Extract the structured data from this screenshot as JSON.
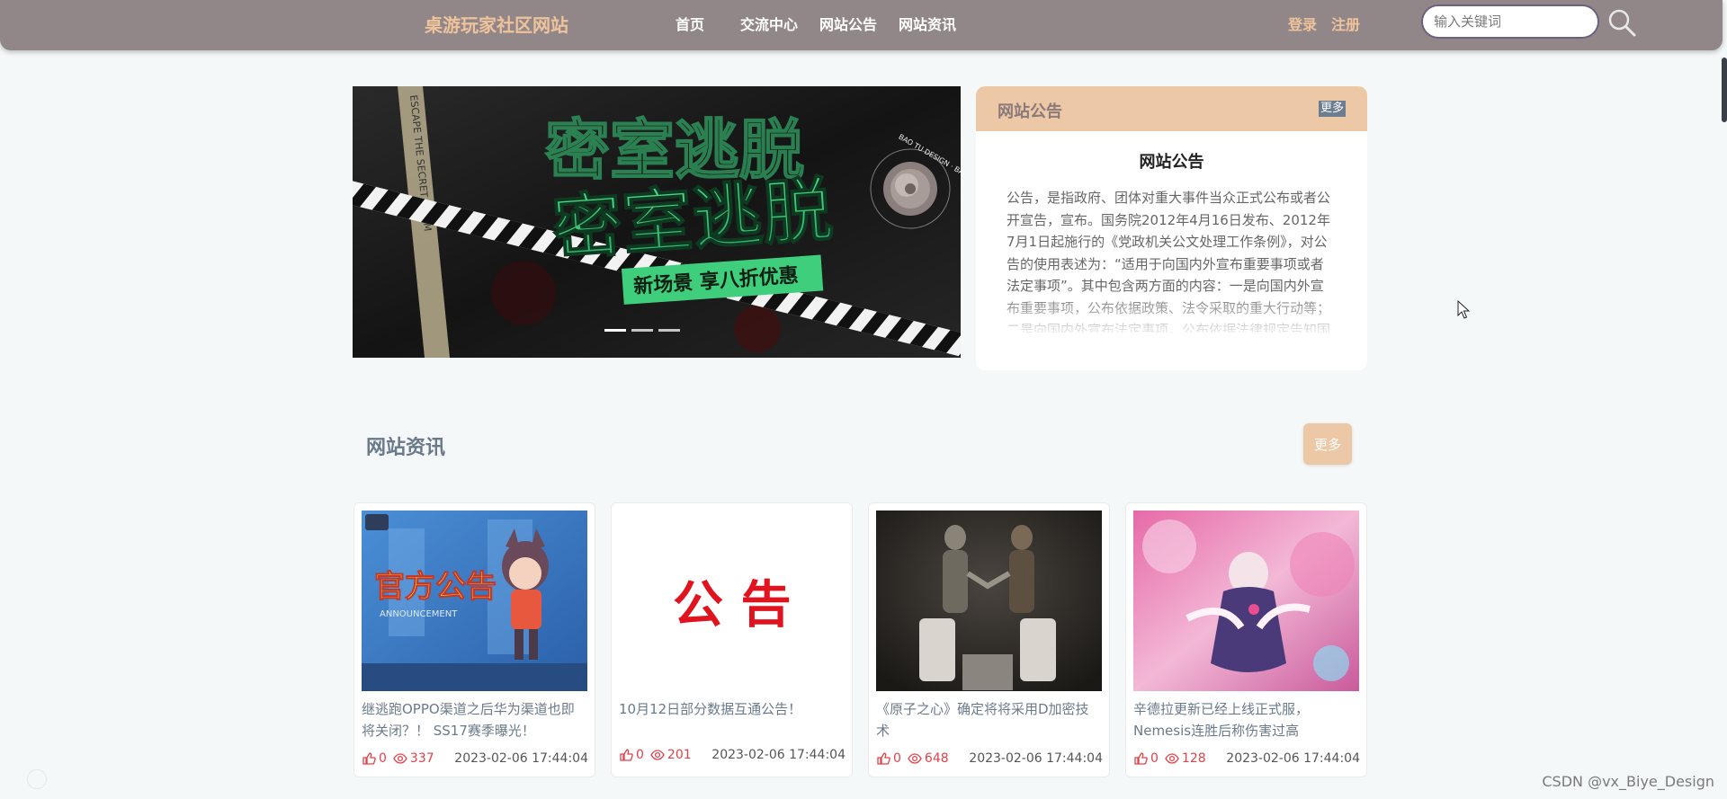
{
  "header": {
    "site_title": "桌游玩家社区网站",
    "nav": [
      "首页",
      "交流中心",
      "网站公告",
      "网站资讯"
    ],
    "login": "登录",
    "register": "注册",
    "search_placeholder": "输入关键词",
    "search_icon": "magnifier-icon"
  },
  "banner": {
    "headline": "密室逃脱",
    "tagline": "新场景 享八折优惠",
    "side_text": "ESCAPE THE SECRET ROOM",
    "badge_text": "BAO TU DESIGN · BAO TU DESIGN ·",
    "slides": 3,
    "active_slide": 1
  },
  "notice": {
    "header_title": "网站公告",
    "more": "更多",
    "title": "网站公告",
    "body": "公告，是指政府、团体对重大事件当众正式公布或者公开宣告，宣布。国务院2012年4月16日发布、2012年7月1日起施行的《党政机关公文处理工作条例》，对公告的使用表述为：“适用于向国内外宣布重要事项或者法定事项”。其中包含两方面的内容：一是向国内外宣布重要事项，公布依据政策、法令采取的重大行动等；二是向国内外宣布法定事项，公布依据法律规定告知国内外的有关重要规定"
  },
  "news": {
    "title": "网站资讯",
    "more": "更多",
    "items": [
      {
        "title": "继逃跑OPPO渠道之后华为渠道也即将关闭？！ SS17赛季曝光！",
        "likes": "0",
        "views": "337",
        "date": "2023-02-06 17:44:04",
        "image_text": "官方公告",
        "image_subtext": "ANNOUNCEMENT"
      },
      {
        "title": "10月12日部分数据互通公告！",
        "likes": "0",
        "views": "201",
        "date": "2023-02-06 17:44:04",
        "image_text": "公 告"
      },
      {
        "title": "《原子之心》确定将将采用D加密技术",
        "likes": "0",
        "views": "648",
        "date": "2023-02-06 17:44:04"
      },
      {
        "title": "辛德拉更新已经上线正式服，Nemesis连胜后称伤害过高",
        "likes": "0",
        "views": "128",
        "date": "2023-02-06 17:44:04"
      }
    ]
  },
  "watermark": "CSDN @vx_Biye_Design",
  "colors": {
    "nav_bg": "#928788",
    "accent": "#edc8a7",
    "title_gold": "#eec39c",
    "stat_red": "#e0424a",
    "section_title": "#6b7a8a"
  }
}
